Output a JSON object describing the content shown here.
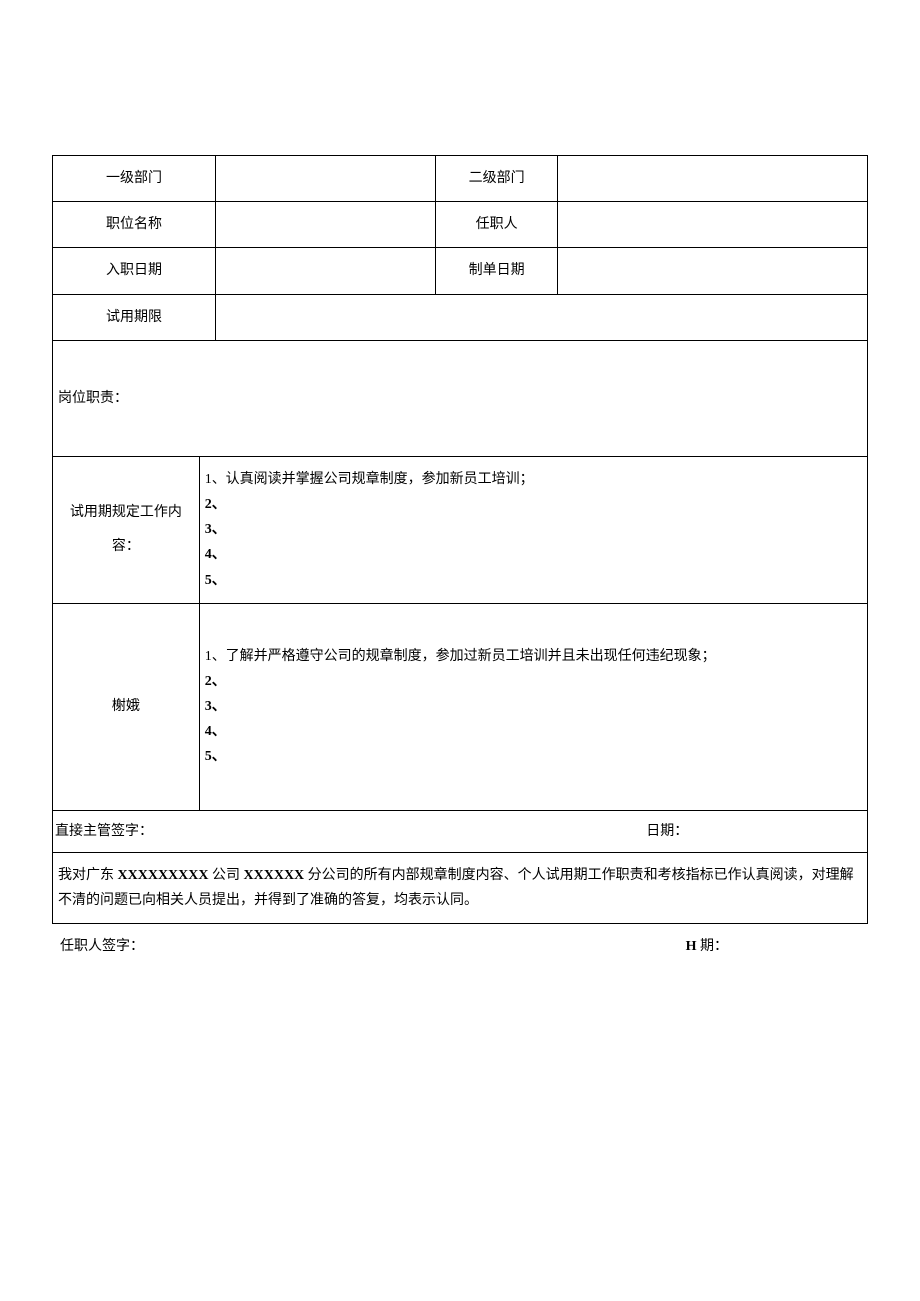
{
  "header": {
    "row1": {
      "label1": "一级部门",
      "val1": "",
      "label2": "二级部门",
      "val2": ""
    },
    "row2": {
      "label1": "职位名称",
      "val1": "",
      "label2": "任职人",
      "val2": ""
    },
    "row3": {
      "label1": "入职日期",
      "val1": "",
      "label2": "制单日期",
      "val2": ""
    },
    "row4": {
      "label1": "试用期限",
      "val1": ""
    }
  },
  "sections": {
    "job_duty": {
      "label": "岗位职责："
    },
    "probation_work": {
      "label": "试用期规定工作内容：",
      "lines": [
        "1、认真阅读并掌握公司规章制度，参加新员工培训；",
        "2、",
        "3、",
        "4、",
        "5、"
      ]
    },
    "evaluation": {
      "label": "榭娥",
      "lines": [
        "1、了解并严格遵守公司的规章制度，参加过新员工培训并且未出现任何违纪现象；",
        "2、",
        "3、",
        "4、",
        "5、"
      ]
    },
    "supervisor_sign": {
      "sign_label": "直接主管签字：",
      "date_label": "日期："
    },
    "declaration": {
      "prefix": "我对广东 ",
      "company1": "XXXXXXXXX",
      "mid1": " 公司 ",
      "company2": "XXXXXX",
      "suffix": " 分公司的所有内部规章制度内容、个人试用期工作职责和考核指标已作认真阅读，对理解不清的问题已向相关人员提出，并得到了准确的答复，均表示认同。"
    }
  },
  "footer": {
    "sign_label": "任职人签字：",
    "date_h": "H",
    "date_suffix": " 期："
  }
}
